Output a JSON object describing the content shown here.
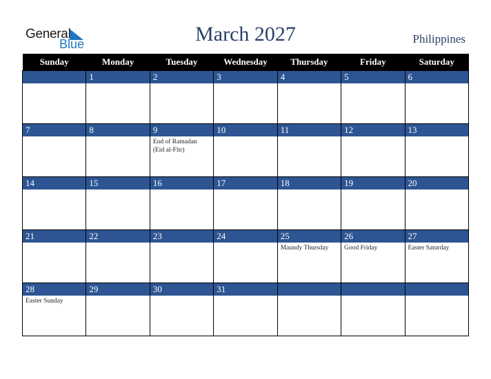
{
  "logo": {
    "word1": "General",
    "word2": "Blue",
    "icon": "triangle-flag-icon",
    "color": "#1f77c0"
  },
  "header": {
    "title": "March 2027",
    "country": "Philippines"
  },
  "colors": {
    "header_bg": "#000000",
    "date_band": "#2d5593",
    "title": "#2a3f66"
  },
  "weekdays": [
    "Sunday",
    "Monday",
    "Tuesday",
    "Wednesday",
    "Thursday",
    "Friday",
    "Saturday"
  ],
  "weeks": [
    [
      {
        "day": "",
        "holiday": ""
      },
      {
        "day": "1",
        "holiday": ""
      },
      {
        "day": "2",
        "holiday": ""
      },
      {
        "day": "3",
        "holiday": ""
      },
      {
        "day": "4",
        "holiday": ""
      },
      {
        "day": "5",
        "holiday": ""
      },
      {
        "day": "6",
        "holiday": ""
      }
    ],
    [
      {
        "day": "7",
        "holiday": ""
      },
      {
        "day": "8",
        "holiday": ""
      },
      {
        "day": "9",
        "holiday": "End of Ramadan (Eid al-Fitr)"
      },
      {
        "day": "10",
        "holiday": ""
      },
      {
        "day": "11",
        "holiday": ""
      },
      {
        "day": "12",
        "holiday": ""
      },
      {
        "day": "13",
        "holiday": ""
      }
    ],
    [
      {
        "day": "14",
        "holiday": ""
      },
      {
        "day": "15",
        "holiday": ""
      },
      {
        "day": "16",
        "holiday": ""
      },
      {
        "day": "17",
        "holiday": ""
      },
      {
        "day": "18",
        "holiday": ""
      },
      {
        "day": "19",
        "holiday": ""
      },
      {
        "day": "20",
        "holiday": ""
      }
    ],
    [
      {
        "day": "21",
        "holiday": ""
      },
      {
        "day": "22",
        "holiday": ""
      },
      {
        "day": "23",
        "holiday": ""
      },
      {
        "day": "24",
        "holiday": ""
      },
      {
        "day": "25",
        "holiday": "Maundy Thursday"
      },
      {
        "day": "26",
        "holiday": "Good Friday"
      },
      {
        "day": "27",
        "holiday": "Easter Saturday"
      }
    ],
    [
      {
        "day": "28",
        "holiday": "Easter Sunday"
      },
      {
        "day": "29",
        "holiday": ""
      },
      {
        "day": "30",
        "holiday": ""
      },
      {
        "day": "31",
        "holiday": ""
      },
      {
        "day": "",
        "holiday": ""
      },
      {
        "day": "",
        "holiday": ""
      },
      {
        "day": "",
        "holiday": ""
      }
    ]
  ]
}
